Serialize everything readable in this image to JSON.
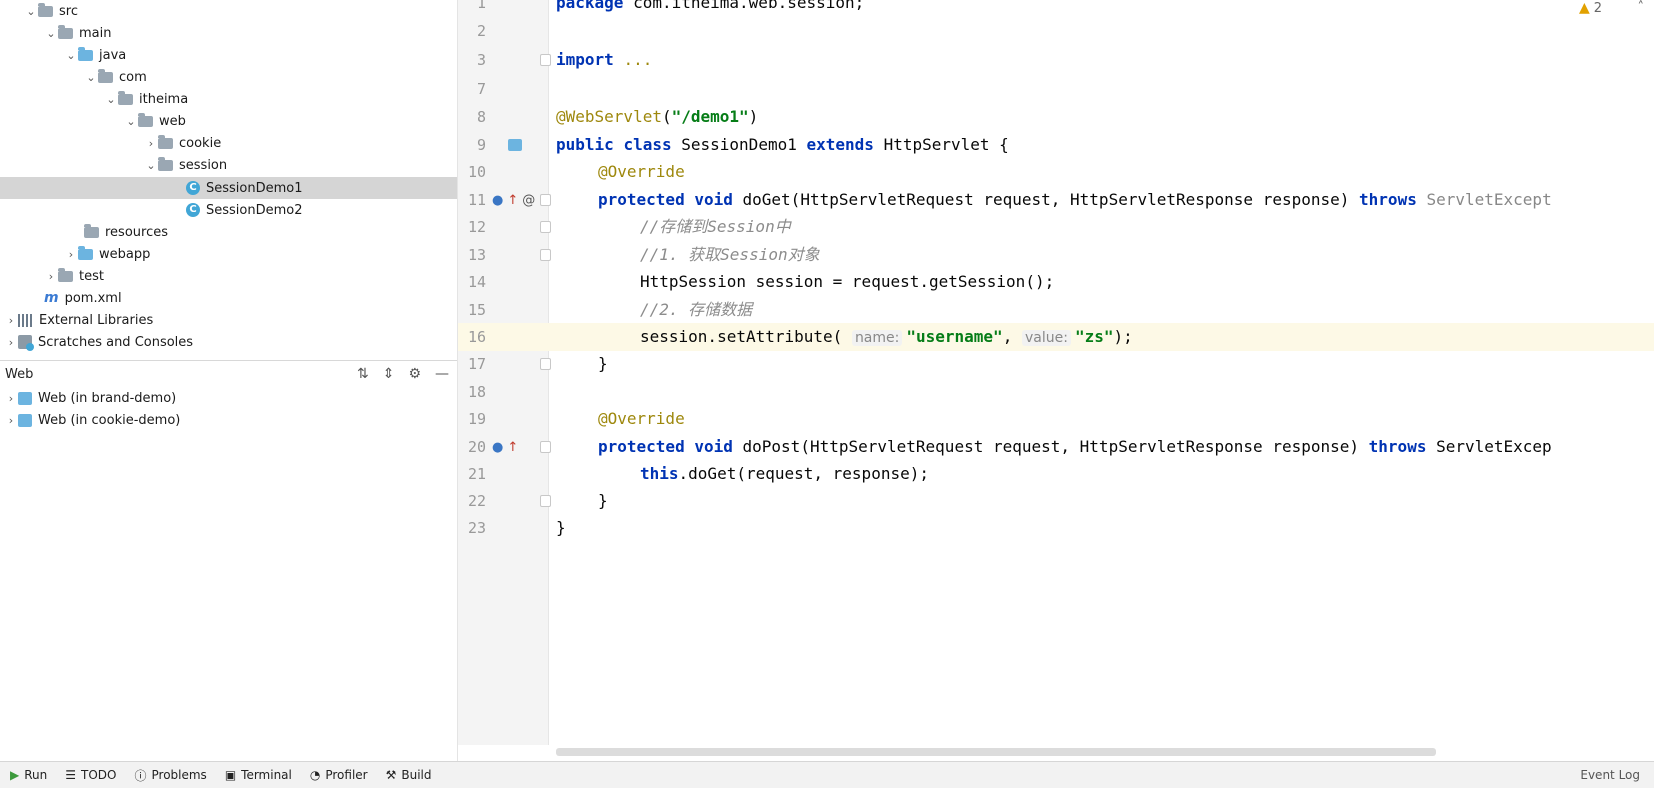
{
  "project_tree": [
    {
      "label": "src",
      "icon": "folder-icon",
      "expanded": true
    },
    {
      "label": "main",
      "icon": "folder-icon",
      "expanded": true
    },
    {
      "label": "java",
      "icon": "source-folder-icon",
      "expanded": true
    },
    {
      "label": "com",
      "icon": "package-icon",
      "expanded": true
    },
    {
      "label": "itheima",
      "icon": "package-icon",
      "expanded": true
    },
    {
      "label": "web",
      "icon": "package-icon",
      "expanded": true
    },
    {
      "label": "cookie",
      "icon": "package-icon",
      "expanded": false
    },
    {
      "label": "session",
      "icon": "package-icon",
      "expanded": true
    },
    {
      "label": "SessionDemo1",
      "icon": "java-class-icon",
      "selected": true
    },
    {
      "label": "SessionDemo2",
      "icon": "java-class-icon"
    },
    {
      "label": "resources",
      "icon": "resources-folder-icon"
    },
    {
      "label": "webapp",
      "icon": "web-folder-icon",
      "expanded": false
    },
    {
      "label": "test",
      "icon": "folder-icon",
      "expanded": false
    },
    {
      "label": "pom.xml",
      "icon": "maven-icon"
    },
    {
      "label": "External Libraries",
      "icon": "libraries-icon",
      "expanded": false
    },
    {
      "label": "Scratches and Consoles",
      "icon": "scratches-icon",
      "expanded": false
    }
  ],
  "web_panel": {
    "title": "Web",
    "items": [
      {
        "label": "Web (in brand-demo)"
      },
      {
        "label": "Web (in cookie-demo)"
      }
    ]
  },
  "editor": {
    "warnings_count": "2",
    "lines": [
      {
        "num": "1",
        "text": "package com.itheima.web.session;"
      },
      {
        "num": "2",
        "text": ""
      },
      {
        "num": "3",
        "text": "import ..."
      },
      {
        "num": "7",
        "text": ""
      },
      {
        "num": "8",
        "text": "@WebServlet(\"/demo1\")"
      },
      {
        "num": "9",
        "text": "public class SessionDemo1 extends HttpServlet {"
      },
      {
        "num": "10",
        "text": "@Override"
      },
      {
        "num": "11",
        "text": "protected void doGet(HttpServletRequest request, HttpServletResponse response) throws ServletExcept"
      },
      {
        "num": "12",
        "text": "//存储到Session中"
      },
      {
        "num": "13",
        "text": "//1. 获取Session对象"
      },
      {
        "num": "14",
        "text": "HttpSession session = request.getSession();"
      },
      {
        "num": "15",
        "text": "//2. 存储数据"
      },
      {
        "num": "16",
        "text": "session.setAttribute( name: \"username\", value: \"zs\");"
      },
      {
        "num": "17",
        "text": "}"
      },
      {
        "num": "18",
        "text": ""
      },
      {
        "num": "19",
        "text": "@Override"
      },
      {
        "num": "20",
        "text": "protected void doPost(HttpServletRequest request, HttpServletResponse response) throws ServletExcep"
      },
      {
        "num": "21",
        "text": "this.doGet(request, response);"
      },
      {
        "num": "22",
        "text": "}"
      },
      {
        "num": "23",
        "text": "}"
      }
    ],
    "tokens": {
      "package_kw": "package",
      "package_name": "com.itheima.web.session;",
      "import_kw": "import",
      "import_dots": "...",
      "ann_webservlet": "@WebServlet",
      "webservlet_open": "(",
      "webservlet_str": "\"/demo1\"",
      "webservlet_close": ")",
      "public_kw": "public",
      "class_kw": "class",
      "class_name": "SessionDemo1",
      "extends_kw": "extends",
      "super_name": "HttpServlet {",
      "override": "@Override",
      "protected_kw": "protected",
      "void_kw": "void",
      "doget_sig": "doGet(HttpServletRequest request, HttpServletResponse response)",
      "throws_kw": "throws",
      "doget_exc": "ServletExcept",
      "c12": "//存储到Session中",
      "c13": "//1. 获取Session对象",
      "l14": "HttpSession session = request.getSession();",
      "c15": "//2. 存储数据",
      "l16_a": "session.setAttribute(",
      "hint_name": "name:",
      "str_username": "\"username\"",
      "comma": ",",
      "hint_value": "value:",
      "str_zs": "\"zs\"",
      "l16_end": ");",
      "brace_close": "}",
      "dopost_sig": "doPost(HttpServletRequest request, HttpServletResponse response)",
      "dopost_exc": "ServletExcep",
      "this_kw": "this",
      "l21": ".doGet(request, response);"
    }
  },
  "bottom_bar": {
    "tabs": [
      {
        "label": "Run",
        "icon": "run-icon"
      },
      {
        "label": "TODO",
        "icon": "todo-icon"
      },
      {
        "label": "Problems",
        "icon": "problems-icon"
      },
      {
        "label": "Terminal",
        "icon": "terminal-icon"
      },
      {
        "label": "Profiler",
        "icon": "profiler-icon"
      },
      {
        "label": "Build",
        "icon": "build-icon"
      }
    ],
    "event_log": "Event Log"
  },
  "colors": {
    "keyword": "#0033b3",
    "annotation": "#9e880d",
    "string": "#067d17",
    "comment": "#8c8c8c",
    "current_line": "#fdf9e6",
    "selected_row": "#d5d5d5"
  }
}
